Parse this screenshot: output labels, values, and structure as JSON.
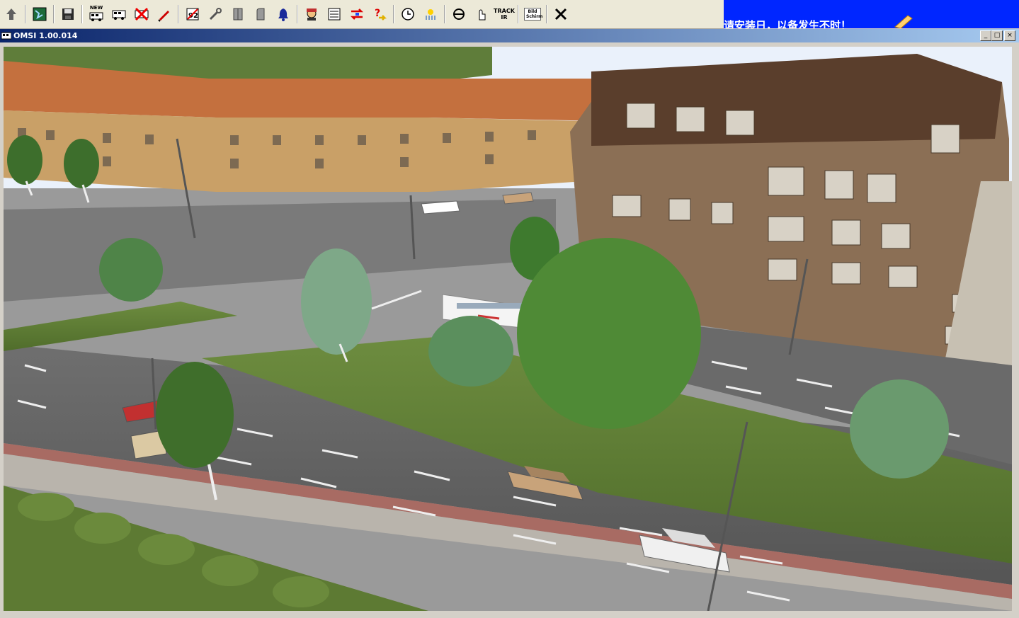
{
  "toolbar": {
    "buttons": [
      {
        "name": "up-arrow-icon"
      },
      {
        "name": "map-icon"
      },
      {
        "name": "save-icon"
      },
      {
        "name": "new-bus-icon",
        "text": "NEW"
      },
      {
        "name": "bus-icon"
      },
      {
        "name": "remove-bus-icon"
      },
      {
        "name": "pen-icon"
      },
      {
        "name": "timetable-icon"
      },
      {
        "name": "tools-icon"
      },
      {
        "name": "door-front-icon"
      },
      {
        "name": "door-rear-icon"
      },
      {
        "name": "bell-icon"
      },
      {
        "name": "driver-icon"
      },
      {
        "name": "schedule-icon"
      },
      {
        "name": "swap-icon"
      },
      {
        "name": "help-icon"
      },
      {
        "name": "clock-icon"
      },
      {
        "name": "weather-icon"
      },
      {
        "name": "steering-icon"
      },
      {
        "name": "hand-icon"
      },
      {
        "name": "trackir-icon",
        "text": "TRACK IR"
      },
      {
        "name": "screenshot-icon",
        "text": "Bild Schirm"
      },
      {
        "name": "close-x-icon"
      }
    ]
  },
  "banner": {
    "text": "请安装日，以备发生不时！",
    "bg": "#0026ff"
  },
  "window": {
    "title": "OMSI 1.00.014",
    "min": "_",
    "max": "□",
    "close": "×"
  },
  "colors": {
    "title_start": "#0a246a",
    "title_end": "#a6caf0"
  }
}
